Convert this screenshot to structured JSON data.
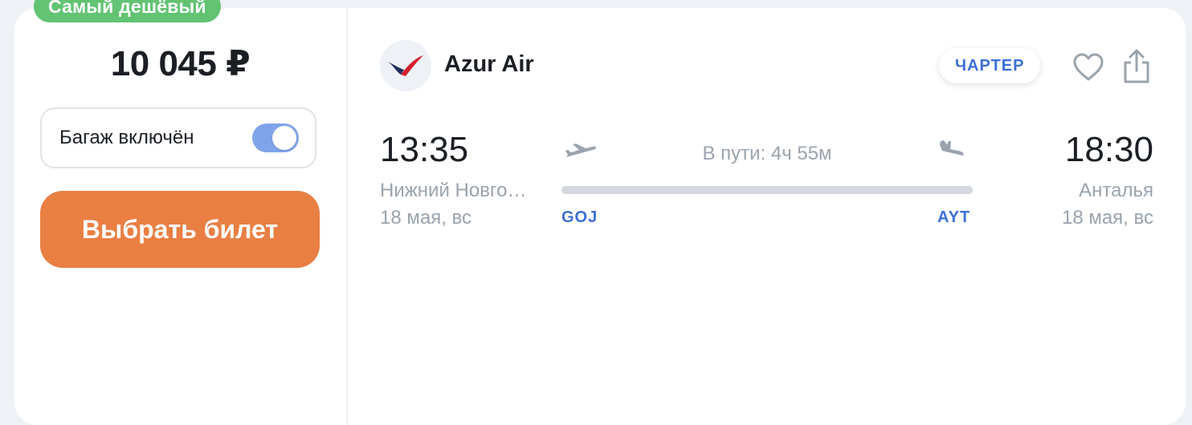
{
  "ticket": {
    "badge": "Самый дешёвый",
    "price": "10 045 ₽",
    "baggage_label": "Багаж включён",
    "baggage_included": true,
    "buy_label": "Выбрать билет"
  },
  "flight": {
    "airline": "Azur Air",
    "charter_label": "ЧАРТЕР",
    "departure": {
      "time": "13:35",
      "city": "Нижний Новго…",
      "date": "18 мая, вс",
      "code": "GOJ"
    },
    "arrival": {
      "time": "18:30",
      "city": "Анталья",
      "date": "18 мая, вс",
      "code": "AYT"
    },
    "duration": "В пути: 4ч 55м"
  },
  "icons": {
    "favorite": "heart-icon",
    "share": "share-icon",
    "takeoff": "plane-takeoff-icon",
    "landing": "plane-landing-icon"
  },
  "colors": {
    "badge": "#62c373",
    "buy_button": "#e97f43",
    "accent": "#3b6fd8",
    "toggle": "#7fa4ea"
  }
}
